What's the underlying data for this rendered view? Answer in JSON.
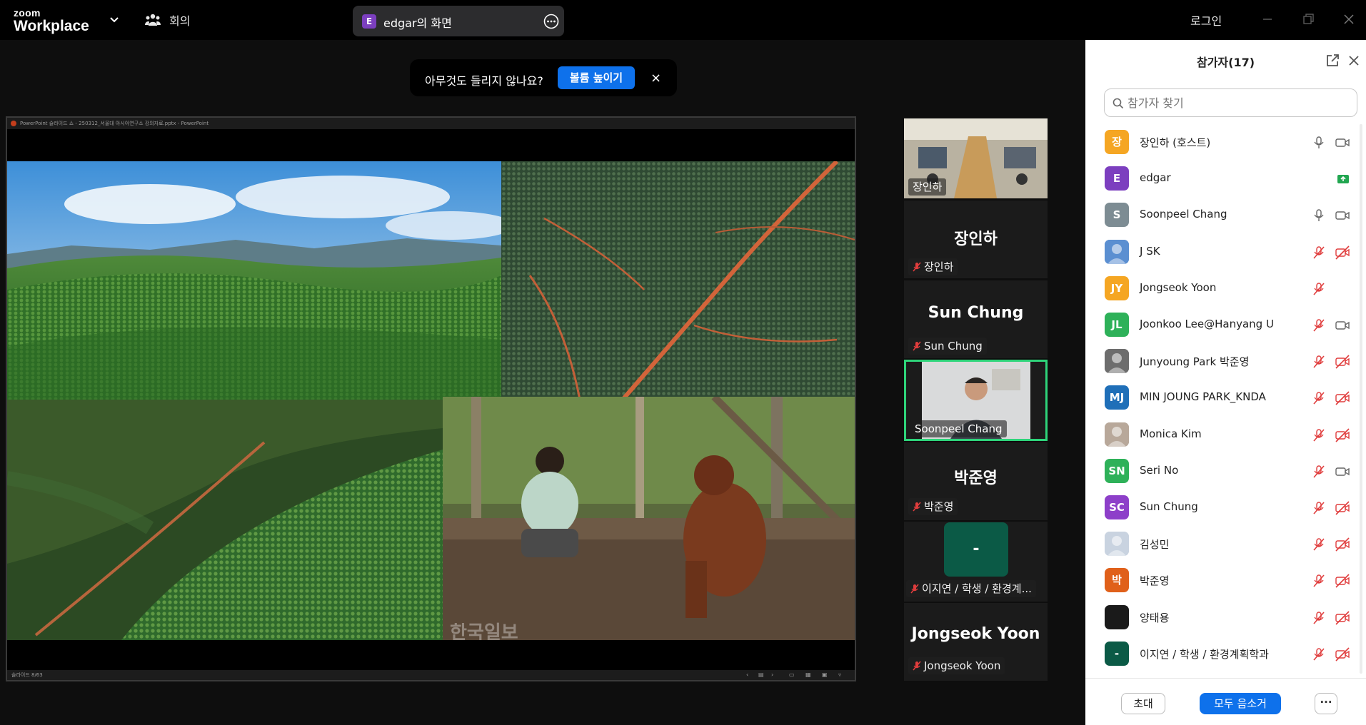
{
  "topbar": {
    "brand_small": "zoom",
    "brand_big": "Workplace",
    "meetings_label": "회의",
    "share_avatar": "E",
    "share_title": "edgar의 화면",
    "login_label": "로그인"
  },
  "banner": {
    "message": "아무것도 들리지 않나요?",
    "button": "볼륨 높이기",
    "close": "×"
  },
  "powerpoint": {
    "title": "PowerPoint 슬라이드 쇼 - 250312_서울대 아시아연구소 강의자료.pptx - PowerPoint",
    "status": "슬라이드 8/63",
    "watermark": "한국일보"
  },
  "tiles": [
    {
      "kind": "video",
      "label": "장인하"
    },
    {
      "kind": "name",
      "big": "장인하",
      "label": "장인하"
    },
    {
      "kind": "name",
      "big": "Sun Chung",
      "label": "Sun Chung"
    },
    {
      "kind": "video",
      "label": "Soonpeel Chang",
      "active": true
    },
    {
      "kind": "name",
      "big": "박준영",
      "label": "박준영"
    },
    {
      "kind": "avatar",
      "avatar": "-",
      "label": "이지연 / 학생 / 환경계..."
    },
    {
      "kind": "name",
      "big": "Jongseok Yoon",
      "label": "Jongseok Yoon"
    }
  ],
  "panel": {
    "title": "참가자(17)",
    "search_placeholder": "참가자 찾기",
    "participants": [
      {
        "avatar": "장",
        "color": "#f5a623",
        "name": "장인하 (호스트)",
        "mic": "on",
        "cam": "on"
      },
      {
        "avatar": "E",
        "color": "#7c3fbf",
        "name": "edgar",
        "mic": "none",
        "cam": "share"
      },
      {
        "avatar": "S",
        "color": "#7d8c93",
        "name": "Soonpeel Chang",
        "mic": "on",
        "cam": "on"
      },
      {
        "avatar": "",
        "color": "#5b8fd1",
        "name": "J SK",
        "mic": "muted",
        "cam": "off",
        "photo": true
      },
      {
        "avatar": "JY",
        "color": "#f5a623",
        "name": "Jongseok Yoon",
        "mic": "muted",
        "cam": "none"
      },
      {
        "avatar": "JL",
        "color": "#2eb159",
        "name": "Joonkoo Lee@Hanyang U",
        "mic": "muted",
        "cam": "on"
      },
      {
        "avatar": "",
        "color": "#6d6d6d",
        "name": "Junyoung Park 박준영",
        "mic": "muted",
        "cam": "off",
        "photo": true
      },
      {
        "avatar": "MJ",
        "color": "#1f6fb8",
        "name": "MIN JOUNG PARK_KNDA",
        "mic": "muted",
        "cam": "off"
      },
      {
        "avatar": "",
        "color": "#b8a89a",
        "name": "Monica Kim",
        "mic": "muted",
        "cam": "off",
        "photo": true
      },
      {
        "avatar": "SN",
        "color": "#2eb159",
        "name": "Seri No",
        "mic": "muted",
        "cam": "on"
      },
      {
        "avatar": "SC",
        "color": "#8d3fc9",
        "name": "Sun Chung",
        "mic": "muted",
        "cam": "off"
      },
      {
        "avatar": "",
        "color": "#c9d3e0",
        "name": "김성민",
        "mic": "muted",
        "cam": "off",
        "photo": true
      },
      {
        "avatar": "박",
        "color": "#e0601a",
        "name": "박준영",
        "mic": "muted",
        "cam": "off"
      },
      {
        "avatar": "",
        "color": "#1a1a1a",
        "name": "양태용",
        "mic": "muted",
        "cam": "off"
      },
      {
        "avatar": "-",
        "color": "#0b5a46",
        "name": "이지연 / 학생 / 환경계획학과",
        "mic": "muted",
        "cam": "off"
      },
      {
        "avatar": "",
        "color": "#f5a623",
        "name": "",
        "mic": "none",
        "cam": "none"
      }
    ],
    "invite_label": "초대",
    "mute_all_label": "모두 음소거",
    "more_label": "···"
  }
}
